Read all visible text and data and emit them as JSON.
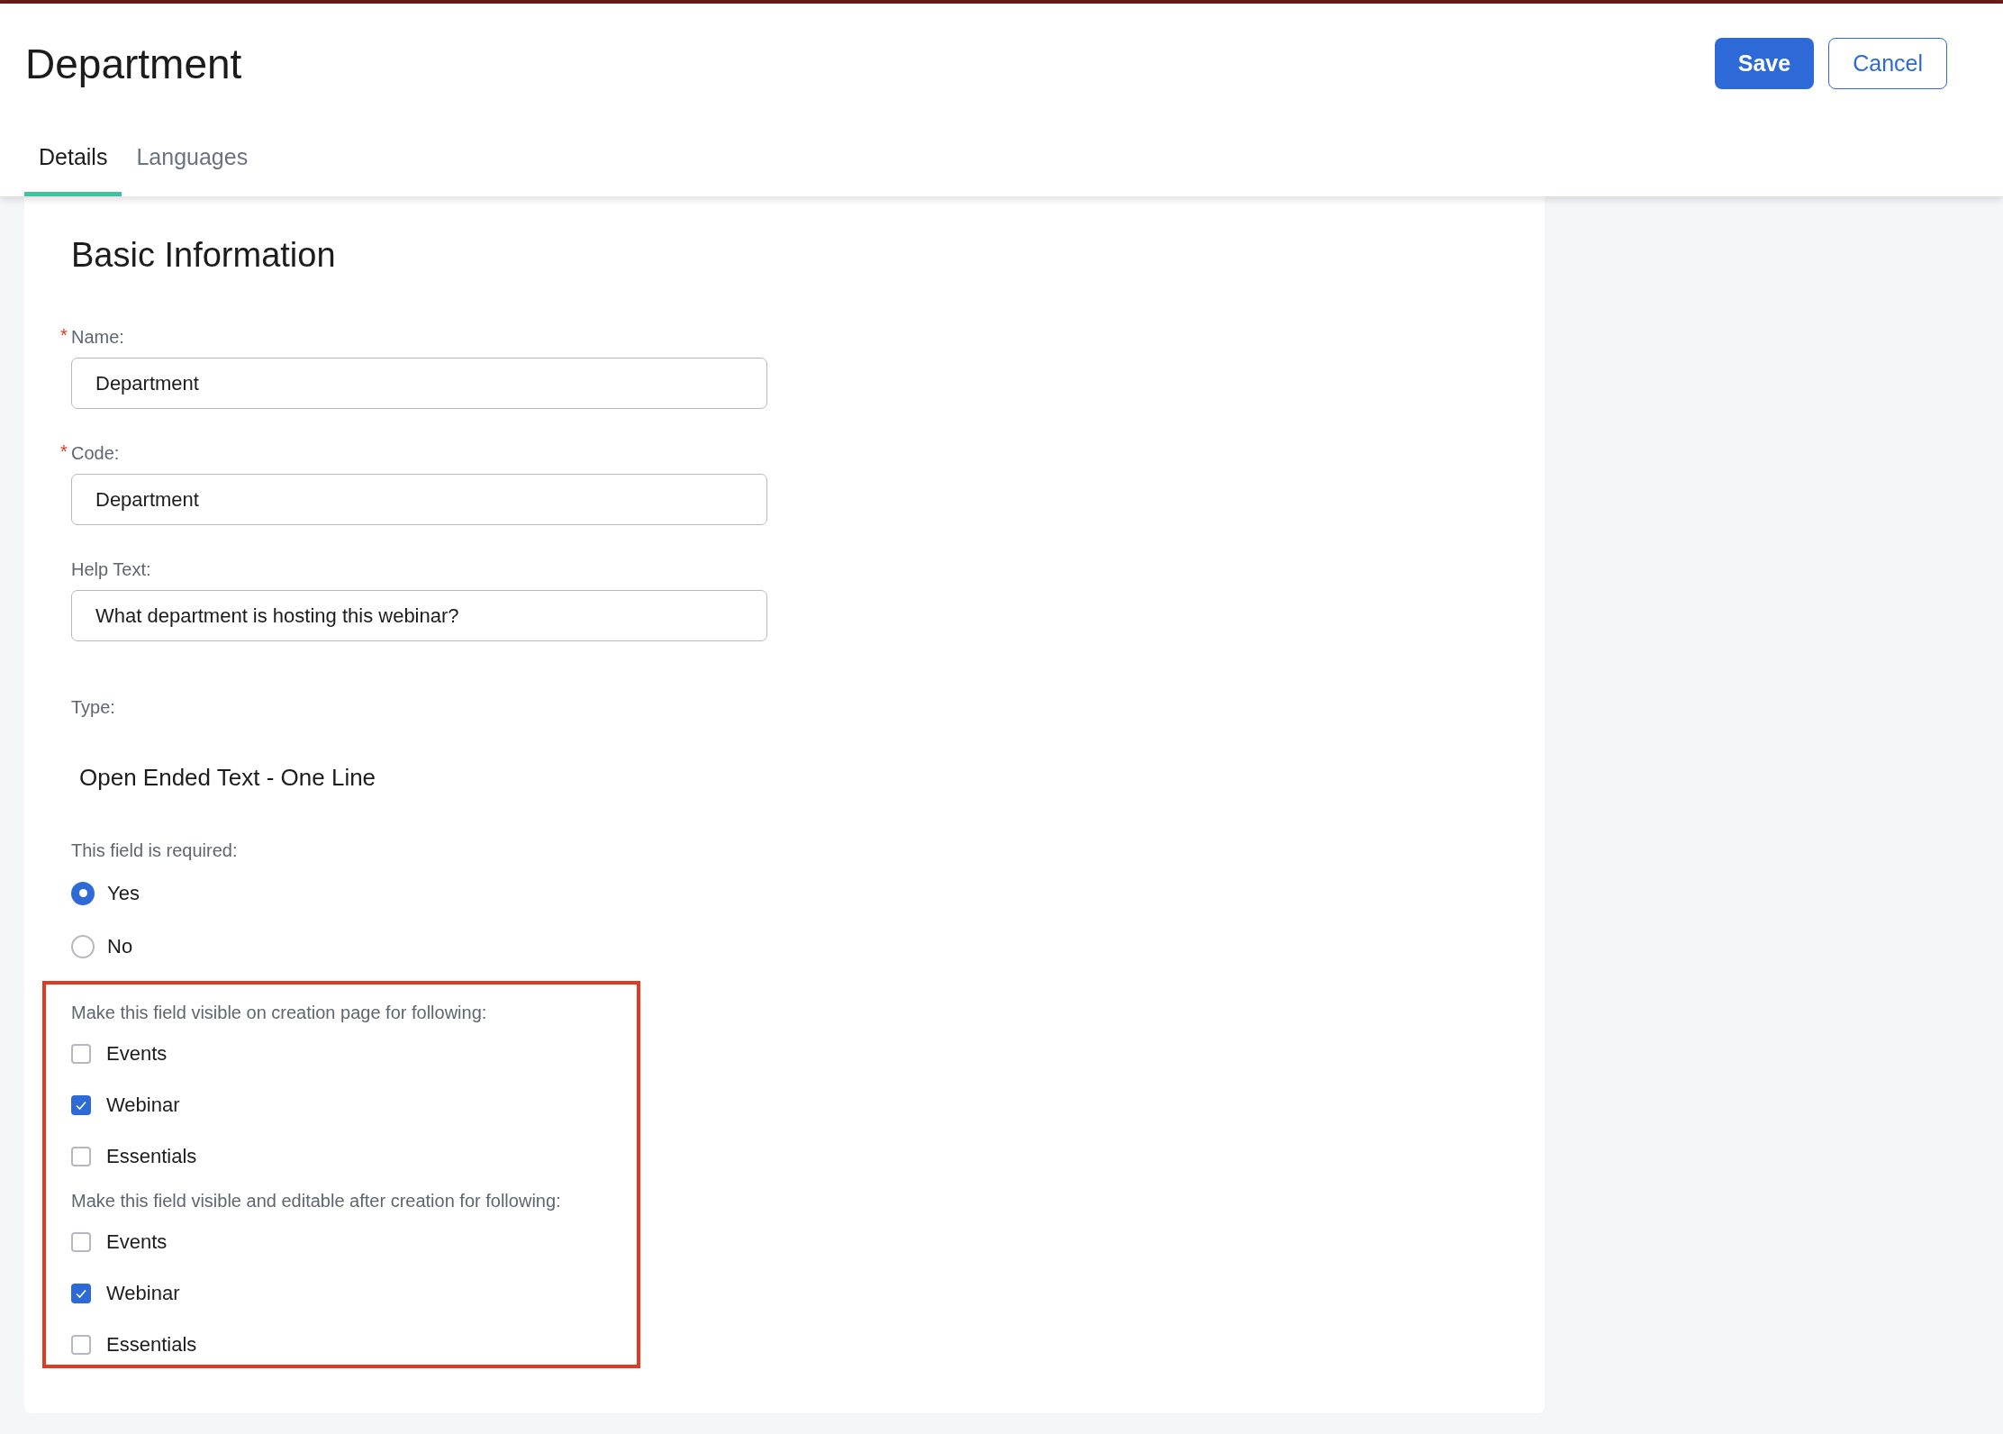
{
  "header": {
    "title": "Department",
    "actions": [
      {
        "label": "Save",
        "kind": "primary"
      },
      {
        "label": "Cancel",
        "kind": "secondary"
      }
    ]
  },
  "tabs": [
    {
      "label": "Details",
      "selected": true
    },
    {
      "label": "Languages",
      "selected": false
    }
  ],
  "section": {
    "title": "Basic Information"
  },
  "fields": [
    {
      "required_mark": "*",
      "label": "Name:",
      "value": "Department"
    },
    {
      "required_mark": "*",
      "label": "Code:",
      "value": "Department"
    },
    {
      "label": "Help Text:",
      "value": "What department is hosting this webinar?"
    }
  ],
  "type": {
    "label": "Type:",
    "value": "Open Ended Text - One Line"
  },
  "required_question": {
    "label": "This field is required:",
    "options": [
      {
        "label": "Yes",
        "selected": true
      },
      {
        "label": "No",
        "selected": false
      }
    ]
  },
  "visibility_groups": [
    {
      "label": "Make this field visible on creation page for following:",
      "options": [
        {
          "label": "Events",
          "checked": false
        },
        {
          "label": "Webinar",
          "checked": true
        },
        {
          "label": "Essentials",
          "checked": false
        }
      ]
    },
    {
      "label": "Make this field visible and editable after creation for following:",
      "options": [
        {
          "label": "Events",
          "checked": false
        },
        {
          "label": "Webinar",
          "checked": true
        },
        {
          "label": "Essentials",
          "checked": false
        }
      ]
    }
  ]
}
